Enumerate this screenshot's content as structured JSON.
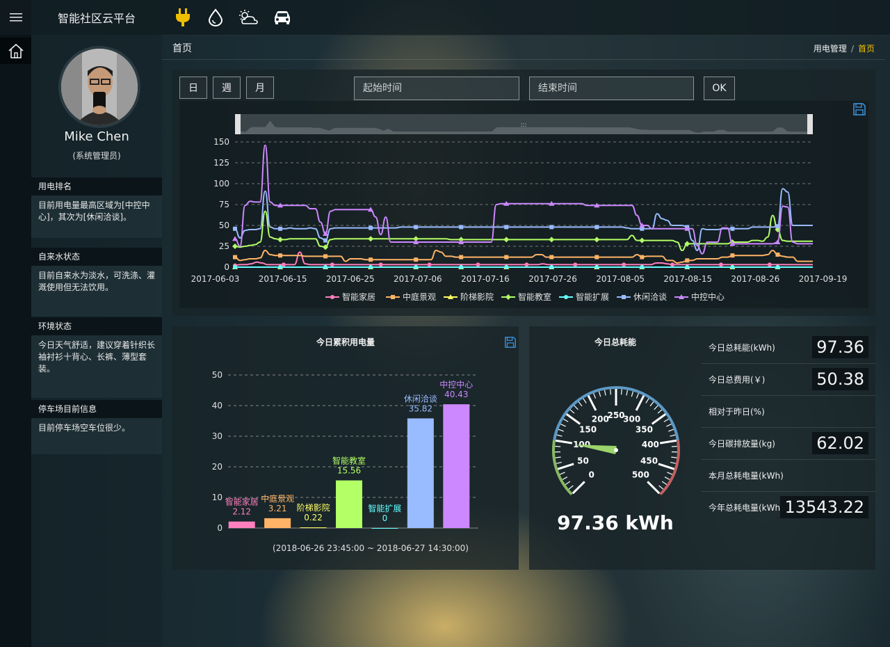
{
  "app": {
    "title": "智能社区云平台",
    "menu_icon": "hamburger-icon",
    "home_icon": "home-icon"
  },
  "topbar": {
    "icons": [
      {
        "name": "power-plug-icon",
        "color": "#f0c000"
      },
      {
        "name": "water-drop-icon",
        "color": "#ffffff"
      },
      {
        "name": "weather-cloud-icon",
        "color": "#ffffff"
      },
      {
        "name": "car-icon",
        "color": "#ffffff"
      }
    ]
  },
  "user": {
    "name": "Mike Chen",
    "role": "(系统管理员)"
  },
  "sidebar": {
    "sections": [
      {
        "title": "用电排名",
        "body": "目前用电量最高区域为[中控中心]，其次为[休闲洽谈]。"
      },
      {
        "title": "自来水状态",
        "body": "目前自来水为淡水，可洗涤、灌溉使用但无法饮用。"
      },
      {
        "title": "环境状态",
        "body": "今日天气舒适，建议穿着针织长袖衬衫十背心、长裤、薄型套装。"
      },
      {
        "title": "停车场目前信息",
        "body": "目前停车场空车位很少。"
      }
    ]
  },
  "page": {
    "title": "首页",
    "breadcrumb": [
      "用电管理",
      "首页"
    ],
    "breadcrumb_sep": "/"
  },
  "filters": {
    "day": "日",
    "week": "週",
    "month": "月",
    "start_placeholder": "起始时间",
    "end_placeholder": "结束时间",
    "ok": "OK",
    "save_icon": "save-icon"
  },
  "colors": {
    "智能家居": "#ff7fbf",
    "中庭景观": "#ffb366",
    "阶梯影院": "#ffff66",
    "智能教室": "#b3ff66",
    "智能扩展": "#66ffff",
    "休闲洽谈": "#99bbff",
    "中控中心": "#cc88ff"
  },
  "chart_data": [
    {
      "type": "line",
      "xlabels": [
        "2017-06-03",
        "2017-06-15",
        "2017-06-25",
        "2017-07-06",
        "2017-07-16",
        "2017-07-26",
        "2017-08-05",
        "2017-08-15",
        "2017-08-26",
        "2017-09-19"
      ],
      "ylim": [
        0,
        150
      ],
      "yticks": [
        0,
        25,
        50,
        75,
        100,
        125,
        150
      ],
      "grid": true,
      "legend_position": "bottom",
      "series": [
        {
          "name": "智能家居",
          "marker": "circle",
          "values": [
            2,
            3,
            3,
            4,
            6,
            5,
            3,
            3,
            3,
            3,
            3,
            3,
            18,
            4,
            3,
            3,
            3,
            3,
            3,
            3,
            3,
            3,
            3,
            3,
            3,
            3,
            3,
            3,
            3,
            3,
            3,
            3,
            3,
            3,
            3,
            3,
            3,
            3,
            3,
            3,
            3,
            3,
            3,
            3,
            3,
            3,
            3,
            3,
            3,
            3,
            3,
            3,
            3,
            3,
            3,
            3,
            3,
            4,
            3,
            3,
            3,
            3,
            3,
            3,
            3,
            3,
            3,
            3,
            3,
            3,
            3,
            3,
            3,
            3,
            3,
            3,
            3,
            3,
            5,
            5,
            4,
            3,
            3,
            3,
            3,
            3,
            3,
            3,
            3,
            3,
            3,
            3,
            3,
            3,
            3,
            3,
            3,
            3,
            3,
            3,
            3,
            3,
            3,
            3,
            3,
            3,
            3,
            3
          ]
        },
        {
          "name": "中庭景观",
          "marker": "square",
          "values": [
            12,
            8,
            9,
            10,
            10,
            11,
            20,
            15,
            14,
            14,
            14,
            14,
            14,
            14,
            13,
            13,
            13,
            13,
            13,
            13,
            13,
            13,
            7,
            10,
            10,
            10,
            9,
            9,
            9,
            9,
            9,
            9,
            9,
            9,
            9,
            9,
            9,
            9,
            9,
            9,
            20,
            18,
            13,
            13,
            12,
            12,
            12,
            12,
            12,
            12,
            12,
            12,
            12,
            12,
            12,
            12,
            12,
            12,
            12,
            12,
            15,
            15,
            12,
            12,
            12,
            12,
            12,
            12,
            12,
            12,
            12,
            12,
            12,
            12,
            12,
            12,
            12,
            12,
            12,
            12,
            15,
            12,
            13,
            13,
            13,
            13,
            8,
            8,
            5,
            6,
            8,
            8,
            10,
            10,
            10,
            10,
            10,
            12,
            12,
            14,
            14,
            14,
            14,
            14,
            14,
            14,
            15,
            20,
            15,
            13,
            12,
            12,
            7,
            7,
            7,
            7
          ]
        },
        {
          "name": "阶梯影院",
          "marker": "triangle",
          "values": [
            0,
            0,
            0,
            0,
            0,
            0,
            0,
            0,
            0,
            0,
            0,
            0,
            0,
            0,
            0,
            0,
            0,
            0,
            0,
            0,
            0,
            0,
            0,
            0,
            0,
            0,
            0,
            0,
            0,
            0,
            0,
            0,
            0,
            0,
            0,
            0,
            0,
            0,
            0,
            0,
            0,
            0,
            0,
            0,
            0,
            0,
            0,
            0,
            0,
            0,
            0,
            0,
            0,
            0,
            0,
            0,
            0,
            0,
            0,
            0,
            0,
            0,
            0,
            0,
            0,
            0,
            0,
            0,
            0,
            0,
            0,
            0,
            0,
            0,
            0,
            0,
            0,
            0,
            0,
            0,
            0,
            0,
            0,
            0,
            0,
            0,
            0,
            0,
            0,
            0,
            0,
            0,
            0,
            0,
            0,
            0,
            0,
            0,
            0,
            0,
            0,
            0,
            0,
            0,
            0,
            0,
            0,
            0,
            0,
            0,
            0,
            0,
            0,
            0,
            0,
            0
          ]
        },
        {
          "name": "智能教室",
          "marker": "diamond",
          "values": [
            25,
            24,
            25,
            26,
            27,
            30,
            67,
            36,
            34,
            33,
            33,
            34,
            34,
            34,
            34,
            34,
            34,
            25,
            24,
            33,
            34,
            34,
            34,
            34,
            34,
            34,
            34,
            34,
            34,
            34,
            34,
            34,
            34,
            34,
            34,
            34,
            34,
            34,
            34,
            34,
            34,
            34,
            34,
            33,
            33,
            33,
            33,
            33,
            33,
            33,
            33,
            33,
            33,
            33,
            33,
            33,
            33,
            33,
            33,
            33,
            33,
            33,
            33,
            33,
            33,
            33,
            33,
            33,
            33,
            33,
            33,
            33,
            33,
            33,
            33,
            33,
            33,
            33,
            33,
            38,
            32,
            32,
            32,
            32,
            32,
            32,
            32,
            32,
            30,
            20,
            28,
            28,
            28,
            28,
            28,
            28,
            28,
            28,
            28,
            30,
            30,
            30,
            30,
            32,
            32,
            31,
            36,
            62,
            45,
            32,
            31,
            31,
            31,
            31,
            31,
            31
          ]
        },
        {
          "name": "智能扩展",
          "marker": "circle",
          "values": [
            0,
            0,
            0,
            0,
            0,
            0,
            0,
            0,
            0,
            0,
            0,
            0,
            0,
            0,
            0,
            0,
            0,
            0,
            0,
            0,
            0,
            0,
            0,
            0,
            0,
            0,
            0,
            0,
            0,
            0,
            0,
            0,
            0,
            0,
            0,
            0,
            0,
            0,
            0,
            0,
            0,
            0,
            0,
            0,
            0,
            0,
            0,
            0,
            0,
            0,
            0,
            0,
            0,
            0,
            0,
            0,
            0,
            0,
            0,
            0,
            0,
            0,
            0,
            0,
            0,
            0,
            0,
            0,
            0,
            0,
            0,
            0,
            0,
            0,
            0,
            0,
            0,
            0,
            0,
            0,
            0,
            0,
            0,
            0,
            0,
            0,
            0,
            0,
            0,
            0,
            0,
            0,
            0,
            0,
            0,
            0,
            0,
            0,
            0,
            0,
            0,
            0,
            0,
            0,
            0,
            0,
            0,
            0,
            0,
            0,
            0,
            0,
            0,
            0,
            0,
            0
          ]
        },
        {
          "name": "休闲洽谈",
          "marker": "square",
          "values": [
            46,
            35,
            44,
            45,
            45,
            46,
            91,
            48,
            46,
            46,
            46,
            47,
            46,
            46,
            46,
            47,
            46,
            35,
            32,
            46,
            47,
            47,
            47,
            47,
            47,
            47,
            47,
            47,
            47,
            47,
            47,
            47,
            47,
            48,
            48,
            48,
            48,
            48,
            48,
            48,
            48,
            48,
            48,
            48,
            48,
            48,
            48,
            48,
            48,
            48,
            48,
            48,
            48,
            48,
            48,
            48,
            48,
            48,
            48,
            48,
            48,
            48,
            48,
            48,
            48,
            48,
            48,
            48,
            48,
            48,
            48,
            48,
            48,
            48,
            48,
            48,
            48,
            48,
            47,
            46,
            46,
            46,
            46,
            46,
            64,
            58,
            56,
            50,
            50,
            50,
            48,
            32,
            20,
            46,
            45,
            45,
            45,
            46,
            46,
            46,
            46,
            46,
            46,
            48,
            48,
            48,
            48,
            48,
            49,
            94,
            90,
            50,
            50,
            50,
            50,
            50
          ]
        },
        {
          "name": "中控中心",
          "marker": "triangle",
          "values": [
            34,
            25,
            74,
            79,
            78,
            78,
            146,
            78,
            74,
            74,
            74,
            74,
            74,
            74,
            74,
            70,
            70,
            54,
            40,
            67,
            69,
            69,
            69,
            69,
            69,
            69,
            69,
            69,
            60,
            39,
            60,
            30,
            30,
            30,
            30,
            30,
            30,
            30,
            30,
            30,
            30,
            30,
            30,
            30,
            30,
            30,
            30,
            30,
            30,
            30,
            30,
            30,
            75,
            76,
            76,
            76,
            76,
            76,
            76,
            76,
            76,
            76,
            76,
            76,
            76,
            76,
            76,
            76,
            76,
            76,
            74,
            74,
            74,
            74,
            74,
            74,
            74,
            74,
            74,
            74,
            62,
            50,
            50,
            46,
            46,
            46,
            46,
            46,
            46,
            46,
            46,
            46,
            26,
            16,
            30,
            30,
            30,
            47,
            47,
            28,
            28,
            28,
            28,
            28,
            28,
            28,
            28,
            28,
            30,
            73,
            72,
            30,
            28,
            28,
            28,
            28
          ]
        }
      ]
    },
    {
      "type": "bar",
      "title": "今日累积用电量",
      "subtitle": "(2018-06-26 23:45:00 ~ 2018-06-27 14:30:00)",
      "ylim": [
        0,
        50
      ],
      "yticks": [
        0,
        10,
        20,
        30,
        40,
        50
      ],
      "grid": true,
      "categories": [
        "智能家居",
        "中庭景观",
        "阶梯影院",
        "智能教室",
        "智能扩展",
        "休闲洽谈",
        "中控中心"
      ],
      "values": [
        2.12,
        3.21,
        0.22,
        15.56,
        0,
        35.82,
        40.43
      ],
      "value_labels": [
        "2.12",
        "3.21",
        "0.22",
        "15.56",
        "0",
        "35.82",
        "40.43"
      ]
    },
    {
      "type": "gauge",
      "title": "今日总耗能",
      "min": 0,
      "max": 500,
      "tick_labels": [
        "0",
        "50",
        "100",
        "150",
        "200",
        "250",
        "300",
        "350",
        "400",
        "450",
        "500"
      ],
      "value": 97.36,
      "detail": "97.36 kWh"
    }
  ],
  "stats": [
    {
      "label": "今日总耗能(kWh)",
      "value": "97.36"
    },
    {
      "label": "今日总费用(￥)",
      "value": "50.38"
    },
    {
      "label": "相对于昨日(%)",
      "value": ""
    },
    {
      "label": "今日碳排放量(kg)",
      "value": "62.02"
    },
    {
      "label": "本月总耗电量(kWh)",
      "value": ""
    },
    {
      "label": "今年总耗电量(kWh)",
      "value": "13543.22"
    }
  ]
}
